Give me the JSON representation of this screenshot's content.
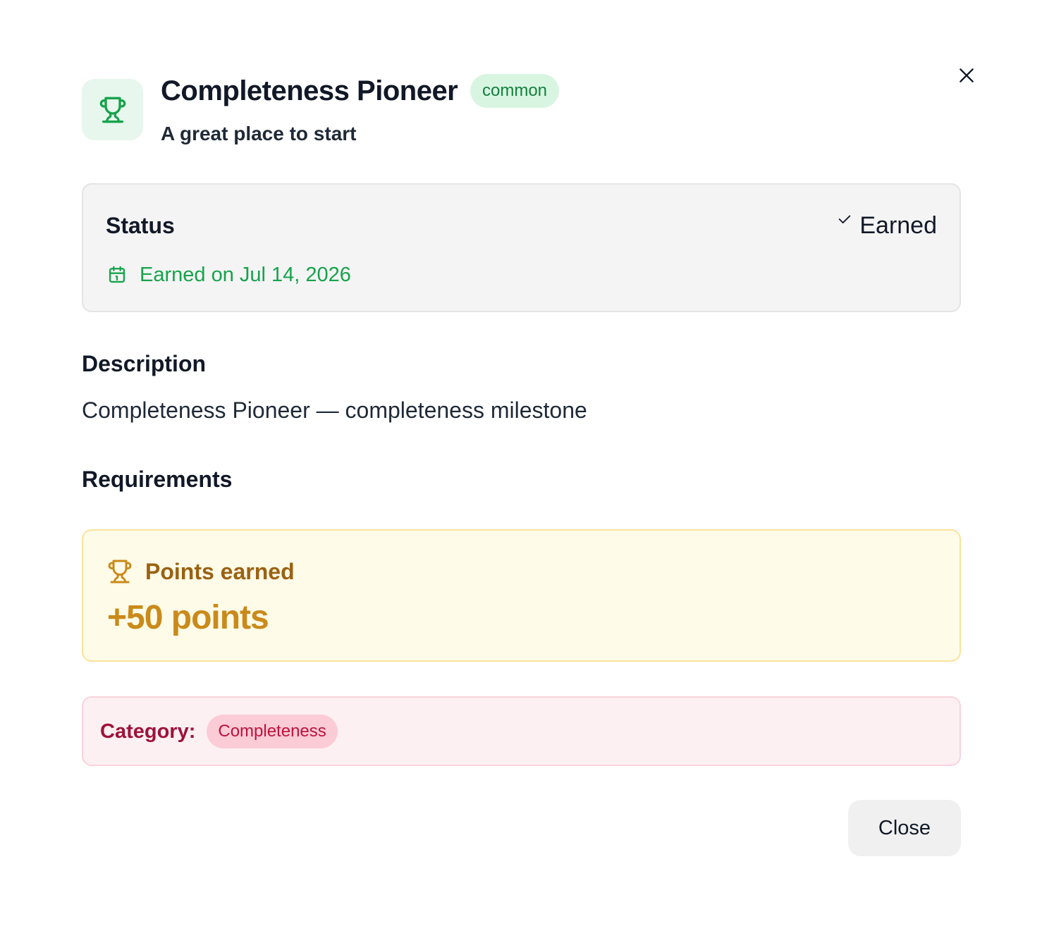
{
  "header": {
    "title": "Completeness Pioneer",
    "rarity": "common",
    "subtitle": "A great place to start",
    "icon": "trophy-icon",
    "close_icon": "close-icon"
  },
  "status": {
    "title": "Status",
    "state_label": "Earned",
    "state_icon": "check-icon",
    "date_icon": "calendar-icon",
    "earned_date": "Earned on Jul 14, 2026"
  },
  "description": {
    "heading": "Description",
    "text": "Completeness Pioneer — completeness milestone"
  },
  "requirements": {
    "heading": "Requirements",
    "points_icon": "trophy-icon",
    "points_label": "Points earned",
    "points_value": "+50 points"
  },
  "category": {
    "label": "Category:",
    "value": "Completeness"
  },
  "footer": {
    "close_label": "Close"
  },
  "colors": {
    "success": "#16a34a",
    "badge_bg": "#d8f5e2",
    "points_text": "#ca8a1a",
    "points_bg": "#fefbe8",
    "category_text": "#9f1239",
    "category_bg": "#fdf0f3"
  }
}
